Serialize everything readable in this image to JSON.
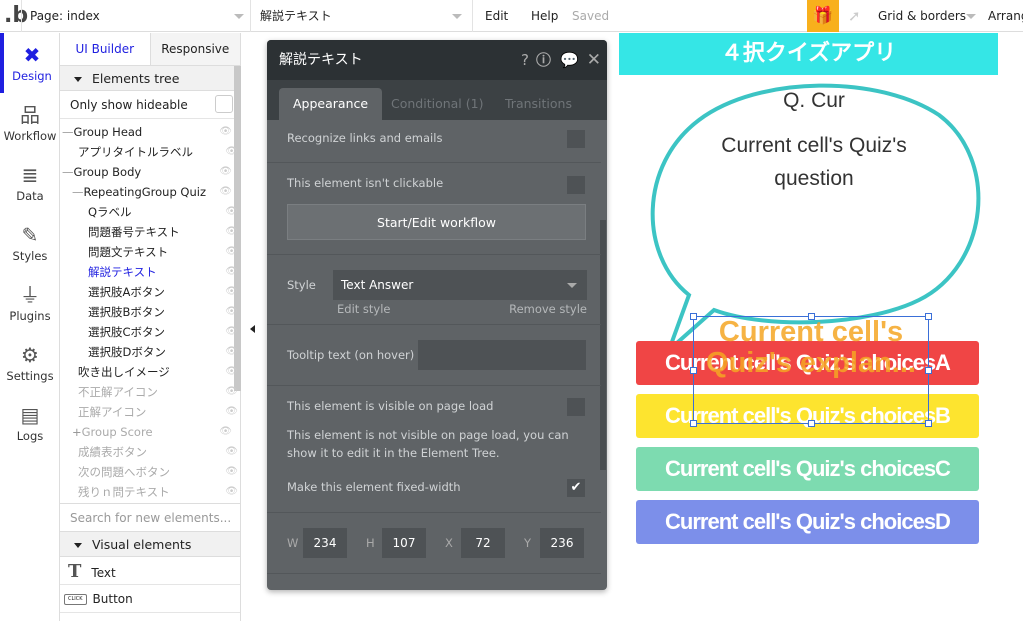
{
  "topbar": {
    "page": "Page: index",
    "element": "解説テキスト",
    "edit": "Edit",
    "help": "Help",
    "saved": "Saved",
    "grid": "Grid & borders",
    "arrange": "Arrang"
  },
  "iconbar": [
    {
      "label": "Design",
      "icon": "design-icon"
    },
    {
      "label": "Workflow",
      "icon": "workflow-icon"
    },
    {
      "label": "Data",
      "icon": "database-icon"
    },
    {
      "label": "Styles",
      "icon": "brush-icon"
    },
    {
      "label": "Plugins",
      "icon": "plug-icon"
    },
    {
      "label": "Settings",
      "icon": "gear-icon"
    },
    {
      "label": "Logs",
      "icon": "document-icon"
    }
  ],
  "tree": {
    "tabs": [
      "UI Builder",
      "Responsive"
    ],
    "section": "Elements tree",
    "only_hideable": "Only show hideable",
    "items": [
      "Group Head",
      "アプリタイトルラベル",
      "Group Body",
      "RepeatingGroup Quiz",
      "Qラベル",
      "問題番号テキスト",
      "問題文テキスト",
      "解説テキスト",
      "選択肢Aボタン",
      "選択肢Bボタン",
      "選択肢Cボタン",
      "選択肢Dボタン",
      "吹き出しイメージ",
      "不正解アイコン",
      "正解アイコン",
      "Group Score",
      "成績表ボタン",
      "次の問題へボタン",
      "残りｎ問テキスト"
    ],
    "search_placeholder": "Search for new elements...",
    "visual": "Visual elements",
    "text": "Text",
    "button": "Button",
    "click": "CLICK"
  },
  "panel": {
    "title": "解説テキスト",
    "tabs": [
      "Appearance",
      "Conditional (1)",
      "Transitions"
    ],
    "recognize": "Recognize links and emails",
    "not_clickable": "This element isn't clickable",
    "workflow_btn": "Start/Edit workflow",
    "style_label": "Style",
    "style_value": "Text Answer",
    "edit_style": "Edit style",
    "remove_style": "Remove style",
    "tooltip": "Tooltip text (on hover)",
    "visible": "This element is visible on page load",
    "visible_note": "This element is not visible on page load, you can show it to edit it in the Element Tree.",
    "fixed_width": "Make this element fixed-width",
    "fixed_width_checked": true,
    "dims": {
      "w_label": "W",
      "w": "234",
      "h_label": "H",
      "h": "107",
      "x_label": "X",
      "x": "72",
      "y_label": "Y",
      "y": "236"
    }
  },
  "canvas": {
    "title": "４択クイズアプリ",
    "q": "Q. Cur",
    "question": "Current cell's Quiz's question",
    "explanation": "Current cell's Quiz's explan...",
    "choices": [
      {
        "label": "Current cell's Quiz's choicesA",
        "color": "#f04545"
      },
      {
        "label": "Current cell's Quiz's choicesB",
        "color": "#fde42f"
      },
      {
        "label": "Current cell's Quiz's choicesC",
        "color": "#7ddbb0"
      },
      {
        "label": "Current cell's Quiz's choicesD",
        "color": "#7c8fea"
      }
    ],
    "title_color": "#35e6e6",
    "accent": "#f5a623"
  }
}
